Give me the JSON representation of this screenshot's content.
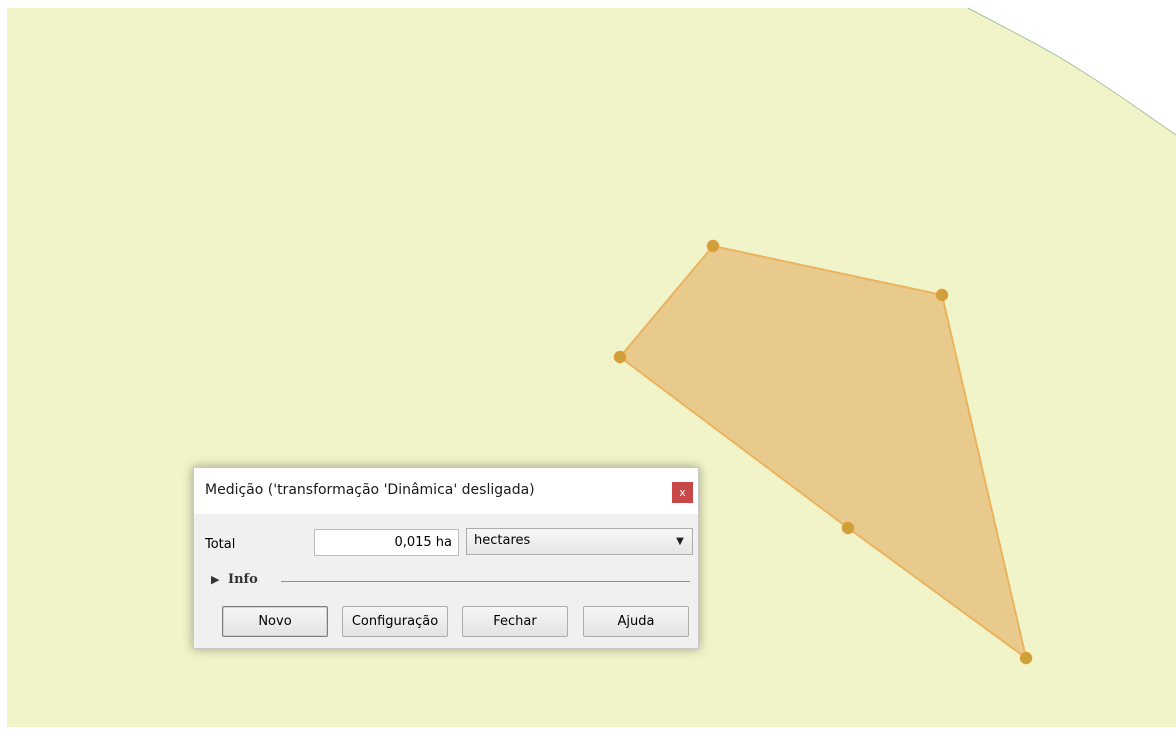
{
  "map": {
    "background_color": "#f1f3c8",
    "outer_color": "#ffffff",
    "boundary_color": "#a7c2a0",
    "polygon_fill": "#e7c889",
    "polygon_stroke": "#e8a84d",
    "vertex_color": "#c9a23a"
  },
  "dialog": {
    "title": "Medição ('transformação 'Dinâmica' desligada)",
    "close_glyph": "x",
    "total_label": "Total",
    "total_value": "0,015 ha",
    "unit_value": "hectares",
    "info_label": "Info",
    "buttons": {
      "new": "Novo",
      "config": "Configuração",
      "close": "Fechar",
      "help": "Ajuda"
    }
  },
  "icons": {
    "dropdown": "chevron-down-icon",
    "expand": "triangle-right-icon",
    "close": "close-icon"
  }
}
